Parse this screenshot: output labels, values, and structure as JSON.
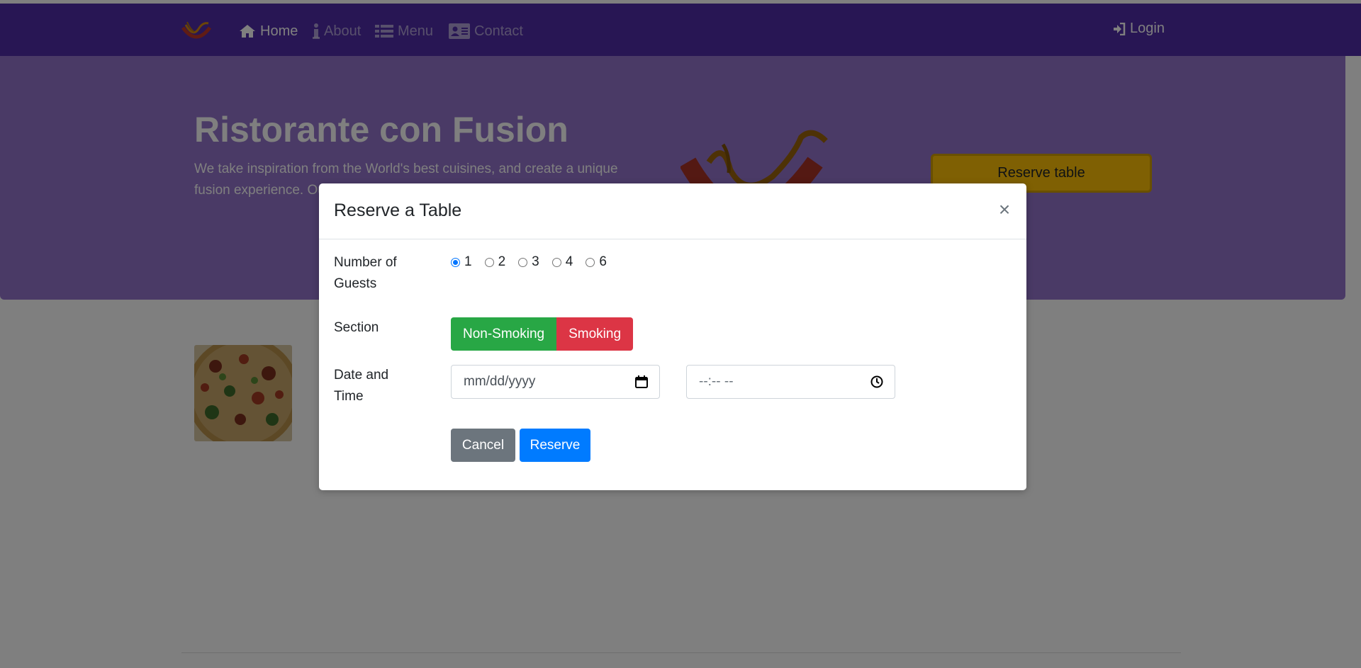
{
  "navbar": {
    "items": [
      {
        "label": "Home",
        "icon": "home-icon",
        "active": true
      },
      {
        "label": "About",
        "icon": "info-icon",
        "active": false
      },
      {
        "label": "Menu",
        "icon": "list-icon",
        "active": false
      },
      {
        "label": "Contact",
        "icon": "address-card-icon",
        "active": false
      }
    ],
    "login_label": "Login"
  },
  "jumbotron": {
    "title": "Ristorante con Fusion",
    "text": "We take inspiration from the World's best cuisines, and create a unique fusion experience. Our lipsmacking creations will tickle your culinary senses!",
    "reserve_button": "Reserve table"
  },
  "modal": {
    "title": "Reserve a Table",
    "close_symbol": "×",
    "guests_label": "Number of Guests",
    "guest_options": [
      "1",
      "2",
      "3",
      "4",
      "6"
    ],
    "selected_guests": "1",
    "section_label": "Section",
    "section_options": [
      "Non-Smoking",
      "Smoking"
    ],
    "datetime_label": "Date and Time",
    "date_placeholder": "mm/dd/yyyy",
    "time_placeholder": "--:-- --",
    "cancel_label": "Cancel",
    "reserve_label": "Reserve"
  },
  "colors": {
    "navbar": "#512da8",
    "jumbotron": "#9575cd",
    "reserve_table": "#ffc107",
    "non_smoking": "#28a745",
    "smoking": "#dc3545",
    "cancel": "#6c757d",
    "reserve": "#007bff"
  }
}
